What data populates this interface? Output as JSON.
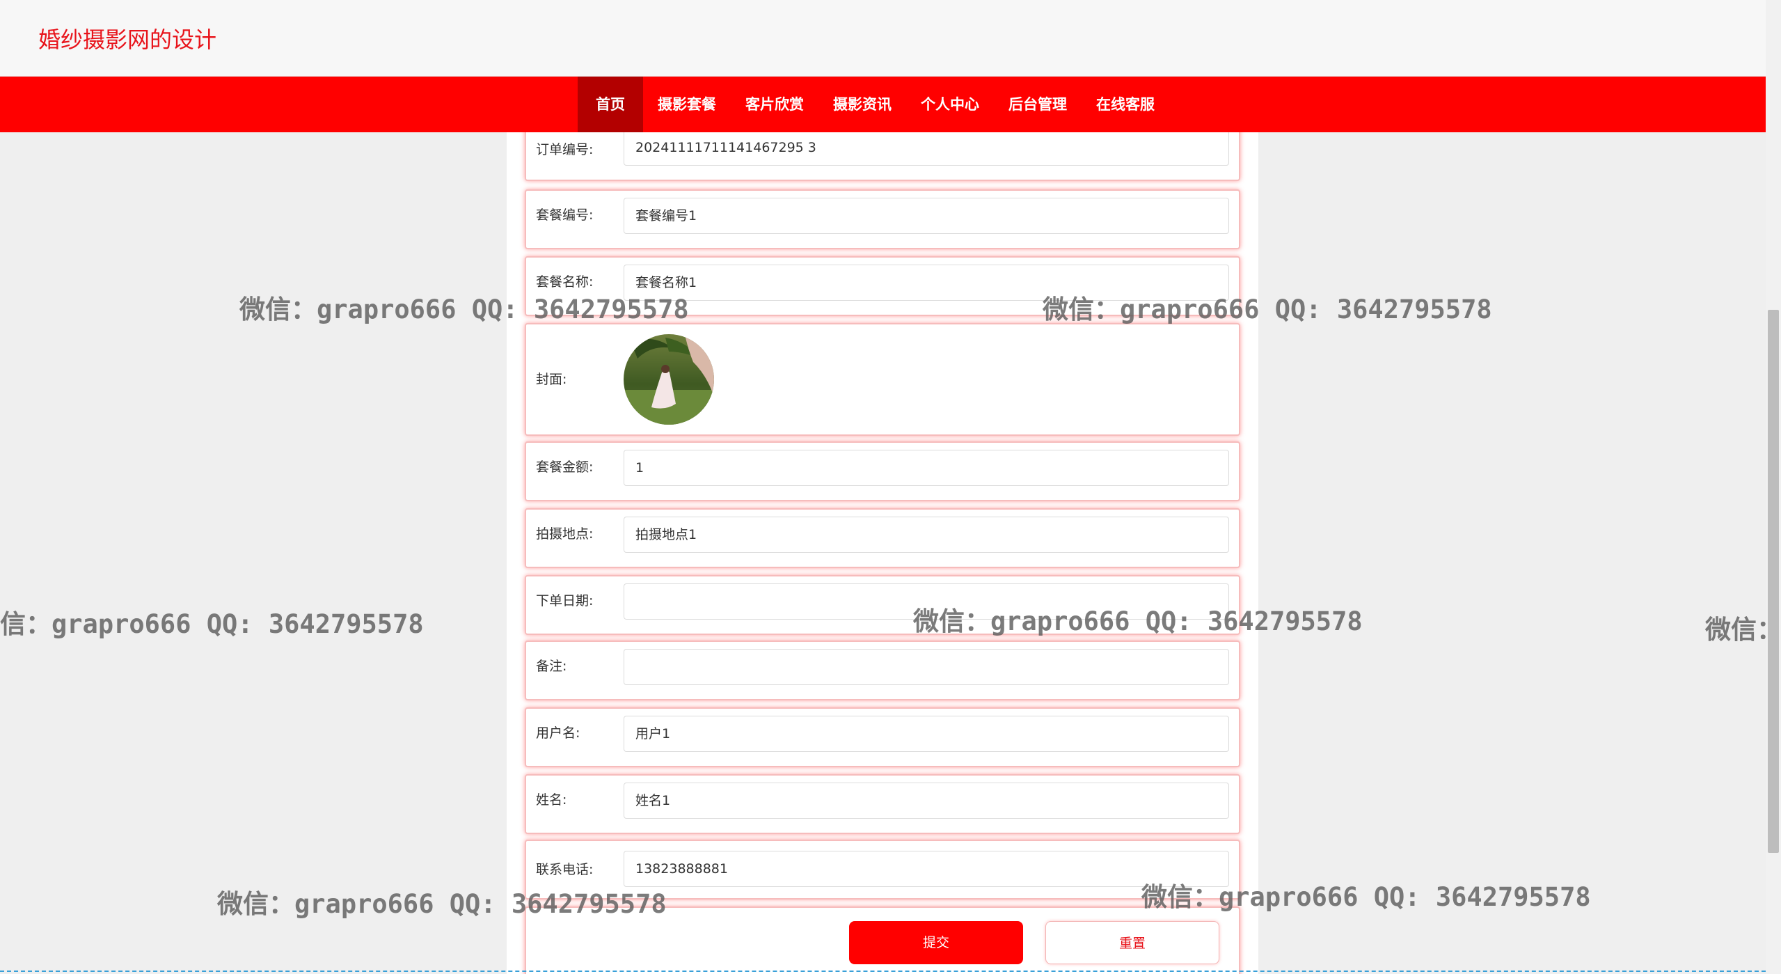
{
  "site": {
    "title": "婚纱摄影网的设计"
  },
  "nav": {
    "items": [
      {
        "label": "首页"
      },
      {
        "label": "摄影套餐"
      },
      {
        "label": "客片欣赏"
      },
      {
        "label": "摄影资讯"
      },
      {
        "label": "个人中心"
      },
      {
        "label": "后台管理"
      },
      {
        "label": "在线客服"
      }
    ]
  },
  "form": {
    "order_no": {
      "label": "订单编号:",
      "value": "20241111711141467295 3"
    },
    "package_no": {
      "label": "套餐编号:",
      "value": "套餐编号1"
    },
    "package_name": {
      "label": "套餐名称:",
      "value": "套餐名称1"
    },
    "cover": {
      "label": "封面:"
    },
    "amount": {
      "label": "套餐金额:",
      "value": "1"
    },
    "location": {
      "label": "拍摄地点:",
      "value": "拍摄地点1"
    },
    "order_date": {
      "label": "下单日期:",
      "value": ""
    },
    "remark": {
      "label": "备注:",
      "value": ""
    },
    "username": {
      "label": "用户名:",
      "value": "用户1"
    },
    "name": {
      "label": "姓名:",
      "value": "姓名1"
    },
    "phone": {
      "label": "联系电话:",
      "value": "13823888881"
    },
    "submit_label": "提交",
    "reset_label": "重置"
  },
  "watermark": {
    "text": "微信：grapro666 QQ: 3642795578",
    "partial": "信：grapro666 QQ: 3642795578",
    "cut": "微信："
  },
  "colors": {
    "brand": "#ff0000",
    "nav_active": "#b30000",
    "title": "#e8141b"
  }
}
